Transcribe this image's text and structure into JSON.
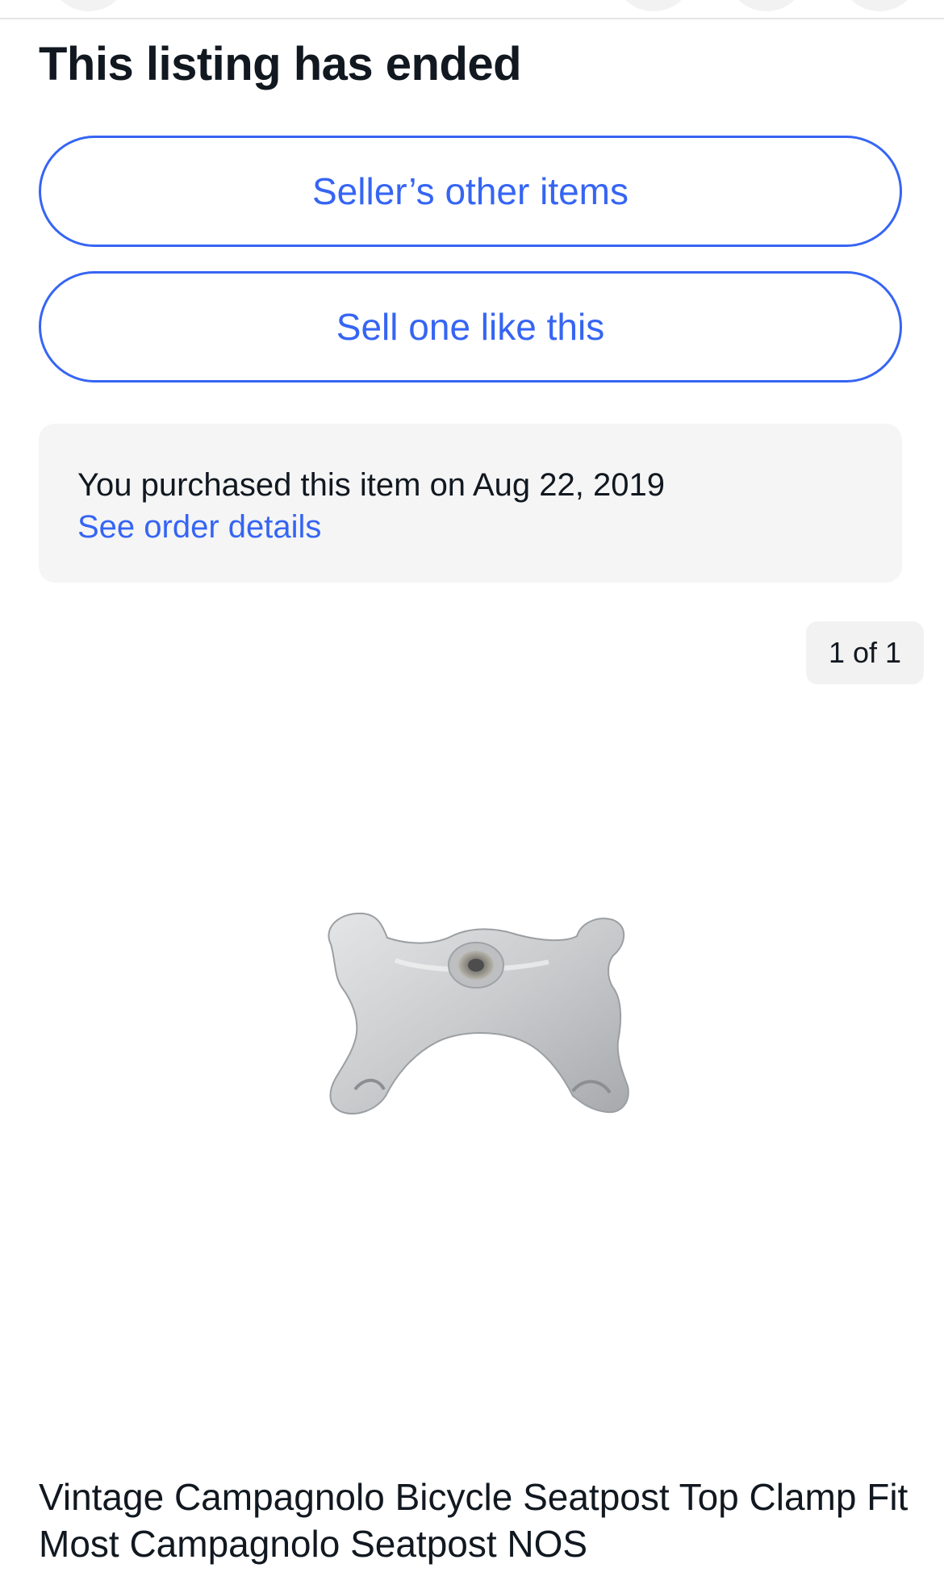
{
  "listing": {
    "status_title": "This listing has ended",
    "sellers_other_items_label": "Seller’s other items",
    "sell_one_like_this_label": "Sell one like this"
  },
  "purchase_notice": {
    "text": "You purchased this item on Aug 22, 2019",
    "link_label": "See order details"
  },
  "gallery": {
    "counter": "1 of 1"
  },
  "product": {
    "title": "Vintage Campagnolo Bicycle Seatpost Top Clamp Fit Most Campagnolo Seatpost NOS"
  },
  "colors": {
    "accent": "#3665f3",
    "text": "#111820",
    "panel_background": "#f5f5f5"
  }
}
